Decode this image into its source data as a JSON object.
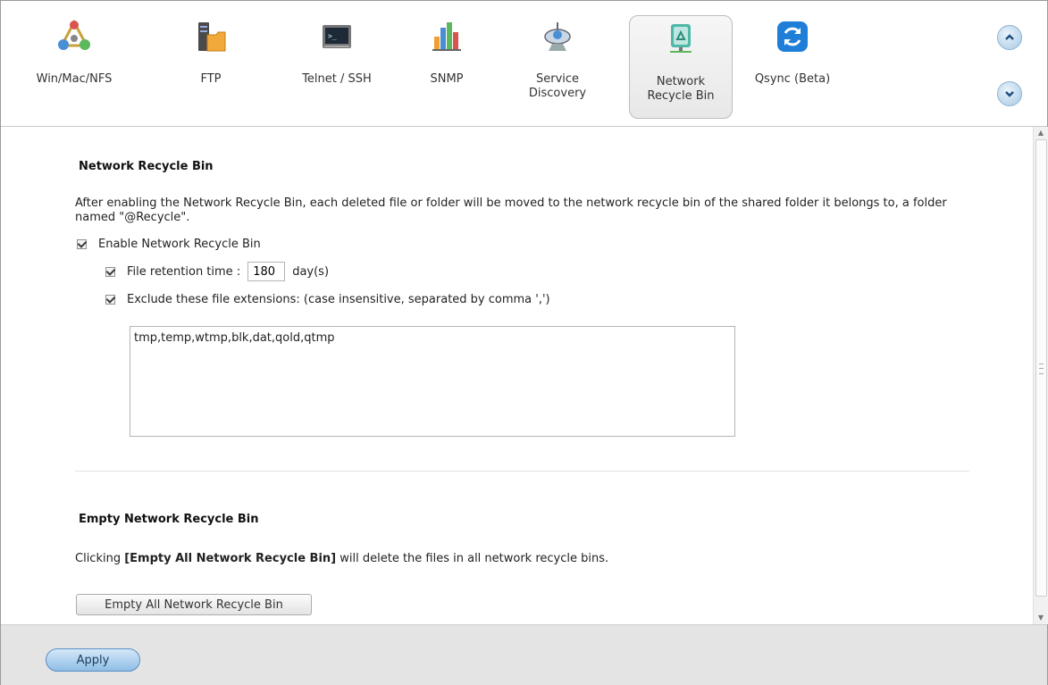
{
  "toolbar": {
    "items": [
      {
        "label": "Win/Mac/NFS",
        "icon": "win-mac-nfs-icon"
      },
      {
        "label": "FTP",
        "icon": "ftp-icon"
      },
      {
        "label": "Telnet / SSH",
        "icon": "telnet-ssh-icon"
      },
      {
        "label": "SNMP",
        "icon": "snmp-icon"
      },
      {
        "label": "Service\nDiscovery",
        "icon": "service-discovery-icon"
      },
      {
        "label": "Network\nRecycle Bin",
        "icon": "network-recycle-bin-icon"
      },
      {
        "label": "Qsync (Beta)",
        "icon": "qsync-icon"
      }
    ],
    "active": "Network Recycle Bin",
    "scroll_up_icon": "chevron-up-icon",
    "scroll_down_icon": "chevron-down-icon"
  },
  "recycle_bin": {
    "title": "Network Recycle Bin",
    "description": "After enabling the Network Recycle Bin, each deleted file or folder will be moved to the network recycle bin of the shared folder it belongs to, a folder named \"@Recycle\".",
    "enable_label": "Enable Network Recycle Bin",
    "enable_checked": true,
    "retention_label": "File retention time :",
    "retention_checked": true,
    "retention_value": "180",
    "retention_unit": "day(s)",
    "exclude_label": "Exclude these file extensions: (case insensitive, separated by comma ',')",
    "exclude_checked": true,
    "exclude_value": "tmp,temp,wtmp,blk,dat,qold,qtmp"
  },
  "empty_section": {
    "title": "Empty Network Recycle Bin",
    "desc_prefix": "Clicking ",
    "desc_bold": "[Empty All Network Recycle Bin]",
    "desc_suffix": " will delete the files in all network recycle bins.",
    "button_label": "Empty All Network Recycle Bin"
  },
  "footer": {
    "apply_label": "Apply"
  }
}
